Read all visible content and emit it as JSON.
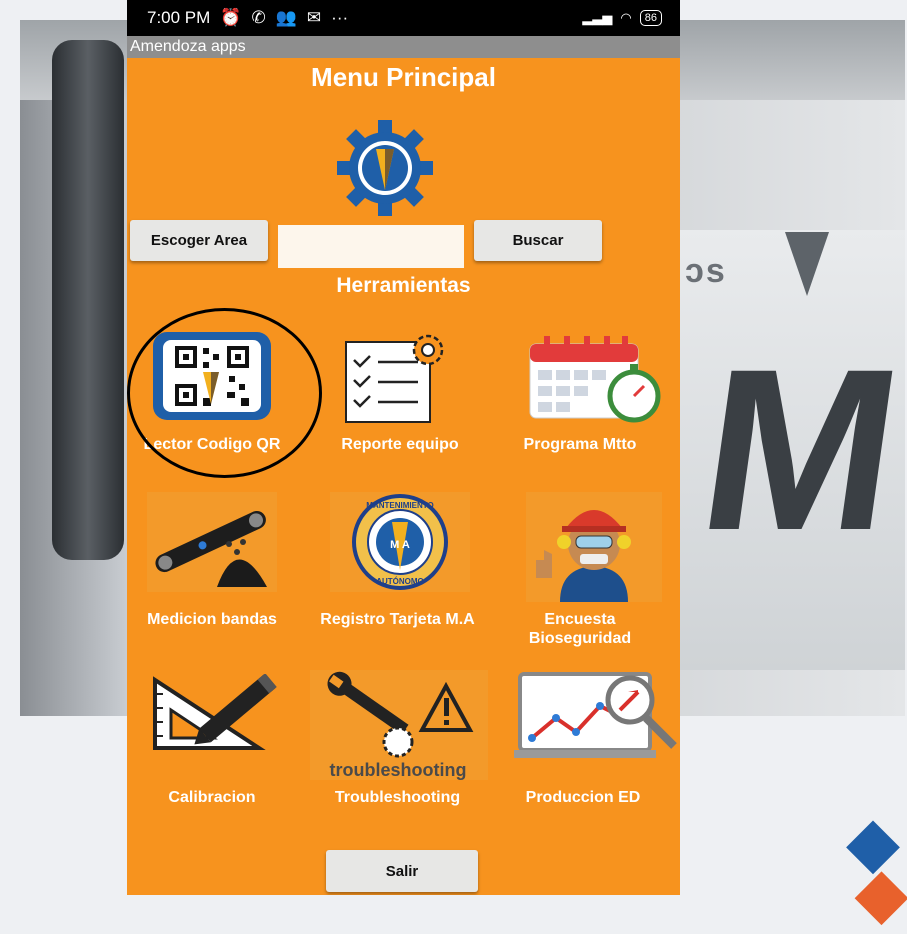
{
  "status_bar": {
    "time": "7:00 PM",
    "icons": [
      "alarm-icon",
      "whatsapp-icon",
      "people-icon",
      "gmail-icon",
      "more-icon"
    ],
    "more": "···",
    "battery": "86"
  },
  "app_bar": {
    "title": "Amendoza apps"
  },
  "page": {
    "title": "Menu Principal",
    "section_title": "Herramientas"
  },
  "controls": {
    "area_button": "Escoger Area",
    "search_value": "",
    "search_button": "Buscar",
    "exit_button": "Salir"
  },
  "tiles": [
    {
      "label": "Lector Codigo QR",
      "icon": "qr-code-icon"
    },
    {
      "label": "Reporte equipo",
      "icon": "checklist-gear-icon"
    },
    {
      "label": "Programa Mtto",
      "icon": "calendar-stopwatch-icon"
    },
    {
      "label": "Medicion bandas",
      "icon": "conveyor-belt-icon"
    },
    {
      "label": "Registro Tarjeta M.A",
      "icon": "mantenimiento-autonomo-badge-icon"
    },
    {
      "label": "Encuesta Bioseguridad",
      "icon": "worker-thumbs-up-icon"
    },
    {
      "label": "Calibracion",
      "icon": "ruler-set-square-icon"
    },
    {
      "label": "Troubleshooting",
      "icon": "wrench-warning-icon"
    },
    {
      "label": "Produccion ED",
      "icon": "laptop-chart-magnifier-icon"
    }
  ],
  "icon_text": {
    "troubleshooting": "troubleshooting",
    "badge_top": "MANTENIMIENTO",
    "badge_bottom": "AUTÓNOMO",
    "badge_center": "M A"
  },
  "colors": {
    "screen_background": "#f7931e",
    "status_bar": "#000000",
    "app_bar": "#8e8e8e",
    "button": "#e7e7e5",
    "logo_blue": "#1f5fa8",
    "logo_gold": "#f2b01e"
  }
}
